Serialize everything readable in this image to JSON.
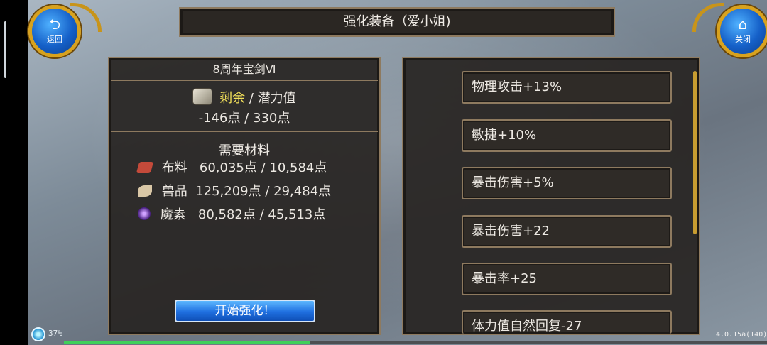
{
  "title": "强化装备（爱小姐)",
  "back_button": {
    "label": "返回",
    "icon": "back-arrow-icon"
  },
  "close_button": {
    "label": "关闭",
    "icon": "home-icon"
  },
  "item": {
    "name": "8周年宝剑Ⅵ",
    "remaining_label": "剩余",
    "separator": "/",
    "potential_label": "潜力值",
    "remaining_value": "-146点",
    "potential_value": "330点"
  },
  "materials": {
    "title": "需要材料",
    "rows": [
      {
        "icon": "cloth-icon",
        "name": "布料",
        "value": "60,035点 / 10,584点"
      },
      {
        "icon": "beast-material-icon",
        "name": "兽品",
        "value": "125,209点 / 29,484点"
      },
      {
        "icon": "magic-element-icon",
        "name": "魔素",
        "value": "80,582点 / 45,513点"
      }
    ]
  },
  "start_button": "开始强化！",
  "stats": [
    "物理攻击+13%",
    "敏捷+10%",
    "暴击伤害+5%",
    "暴击伤害+22",
    "暴击率+25",
    "体力值自然回复-27"
  ],
  "footer": {
    "battery": "37%",
    "progress_fraction": 0.35,
    "version": "4.0.15a(140)"
  },
  "colors": {
    "panel_bg": "#282522",
    "border_gold": "#8e7a5f",
    "highlight_yellow": "#f3e15a",
    "button_blue": "#1f6fe0"
  }
}
